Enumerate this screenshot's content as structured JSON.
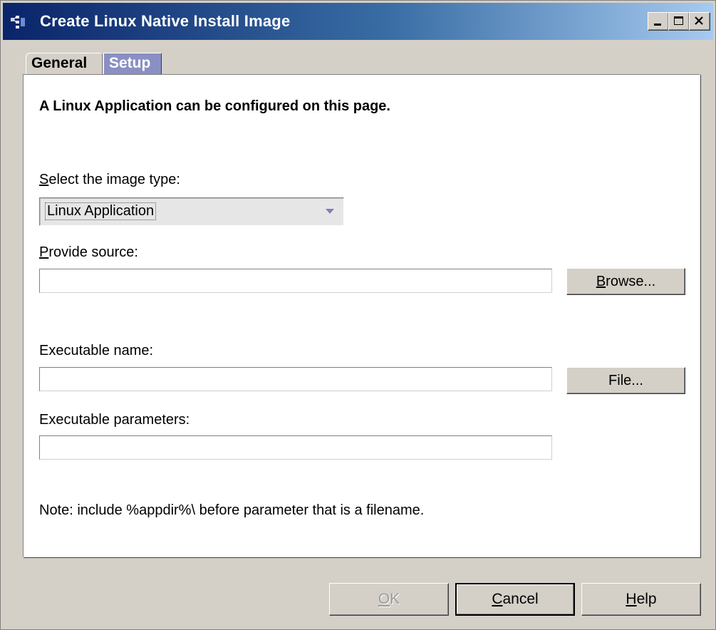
{
  "window": {
    "title": "Create Linux Native Install Image"
  },
  "tabs": [
    {
      "label": "General",
      "active": true
    },
    {
      "label": "Setup",
      "active": false
    }
  ],
  "panel": {
    "heading": "A Linux Application can be configured on this page.",
    "image_type": {
      "label_mnemonic": "S",
      "label_rest": "elect the image type:",
      "selected": "Linux Application"
    },
    "source": {
      "label_mnemonic": "P",
      "label_rest": "rovide source:",
      "value": "",
      "browse_mnemonic": "B",
      "browse_rest": "rowse..."
    },
    "executable_name": {
      "label": "Executable name:",
      "value": "",
      "file_button": "File..."
    },
    "executable_params": {
      "label": "Executable parameters:",
      "value": ""
    },
    "note": "Note: include %appdir%\\ before parameter that is a filename."
  },
  "footer": {
    "ok_mnemonic": "O",
    "ok_rest": "K",
    "cancel_mnemonic": "C",
    "cancel_rest": "ancel",
    "help_mnemonic": "H",
    "help_rest": "elp"
  },
  "colors": {
    "title_gradient_start": "#0a246a",
    "title_gradient_end": "#a6caf0",
    "inactive_tab": "#8a8fc4",
    "dialog_bg": "#d4d0c8"
  },
  "icons": [
    "app-network-icon",
    "minimize-icon",
    "maximize-icon",
    "close-icon",
    "dropdown-arrow-icon"
  ]
}
